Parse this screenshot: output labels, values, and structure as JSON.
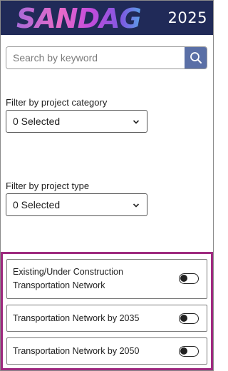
{
  "header": {
    "logo_text": "SANDAG",
    "year": "2025",
    "background": "#202a58"
  },
  "search": {
    "placeholder": "Search by keyword",
    "button_icon": "search-icon",
    "button_color": "#5a6fa6"
  },
  "filters": [
    {
      "label": "Filter by project category",
      "selected": "0 Selected"
    },
    {
      "label": "Filter by project type",
      "selected": "0 Selected"
    }
  ],
  "layers": {
    "border_color": "#9e2a7f",
    "items": [
      {
        "label": "Existing/Under Construction Transportation Network",
        "enabled": false
      },
      {
        "label": "Transportation Network by 2035",
        "enabled": false
      },
      {
        "label": "Transportation Network by 2050",
        "enabled": false
      }
    ]
  }
}
